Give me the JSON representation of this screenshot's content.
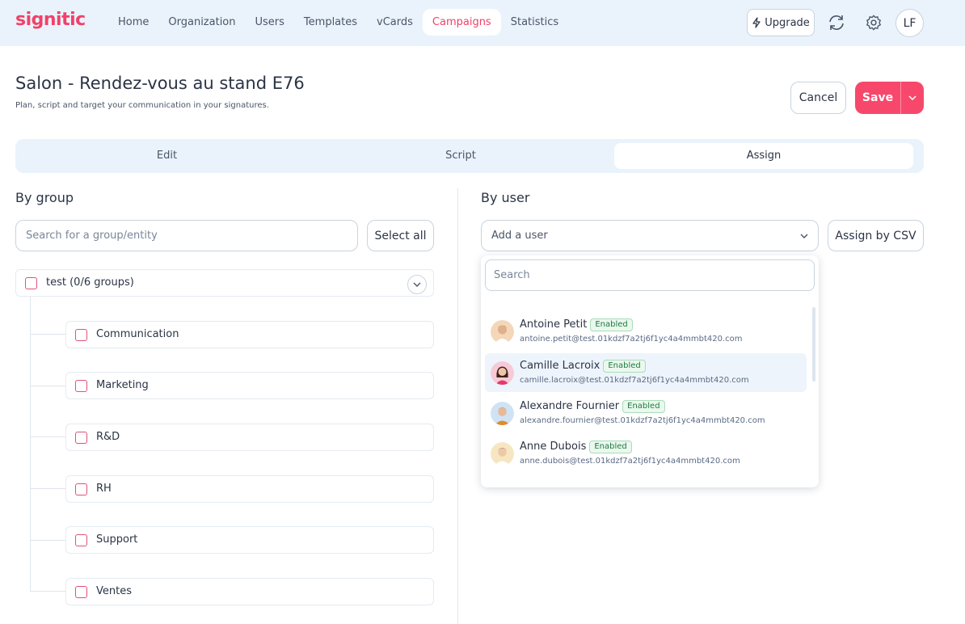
{
  "app": {
    "logo": "signitic"
  },
  "nav": {
    "items": [
      {
        "label": "Home",
        "active": false
      },
      {
        "label": "Organization",
        "active": false
      },
      {
        "label": "Users",
        "active": false
      },
      {
        "label": "Templates",
        "active": false
      },
      {
        "label": "vCards",
        "active": false
      },
      {
        "label": "Campaigns",
        "active": true
      },
      {
        "label": "Statistics",
        "active": false
      }
    ],
    "upgrade_label": "Upgrade",
    "avatar_initials": "LF"
  },
  "header": {
    "title": "Salon - Rendez-vous au stand E76",
    "subtitle": "Plan, script and target your communication in your signatures.",
    "cancel_label": "Cancel",
    "save_label": "Save"
  },
  "tabs": [
    {
      "label": "Edit",
      "active": false
    },
    {
      "label": "Script",
      "active": false
    },
    {
      "label": "Assign",
      "active": true
    }
  ],
  "by_group": {
    "title": "By group",
    "search_placeholder": "Search for a group/entity",
    "select_all_label": "Select all",
    "root": {
      "label": "test (0/6 groups)",
      "checked": false
    },
    "children": [
      {
        "label": "Communication",
        "checked": false
      },
      {
        "label": "Marketing",
        "checked": false
      },
      {
        "label": "R&D",
        "checked": false
      },
      {
        "label": "RH",
        "checked": false
      },
      {
        "label": "Support",
        "checked": false
      },
      {
        "label": "Ventes",
        "checked": false
      }
    ]
  },
  "by_user": {
    "title": "By user",
    "select_placeholder": "Add a user",
    "assign_csv_label": "Assign by CSV",
    "dropdown": {
      "search_placeholder": "Search",
      "users": [
        {
          "name": "Antoine Petit",
          "status": "Enabled",
          "email": "antoine.petit@test.01kdzf7a2tj6f1yc4a4mmbt420.com",
          "avatar_bg": "#f3d7b8",
          "hover": false
        },
        {
          "name": "Camille Lacroix",
          "status": "Enabled",
          "email": "camille.lacroix@test.01kdzf7a2tj6f1yc4a4mmbt420.com",
          "avatar_bg": "#f8c9d6",
          "hover": true
        },
        {
          "name": "Alexandre Fournier",
          "status": "Enabled",
          "email": "alexandre.fournier@test.01kdzf7a2tj6f1yc4a4mmbt420.com",
          "avatar_bg": "#cfe3f5",
          "hover": false
        },
        {
          "name": "Anne Dubois",
          "status": "Enabled",
          "email": "anne.dubois@test.01kdzf7a2tj6f1yc4a4mmbt420.com",
          "avatar_bg": "#f6e6c2",
          "hover": false
        }
      ]
    }
  },
  "colors": {
    "brand": "#f0426a",
    "nav_bg": "#eaf3fc",
    "save": "#f7486c",
    "enabled_badge": "#1f7a3f"
  }
}
